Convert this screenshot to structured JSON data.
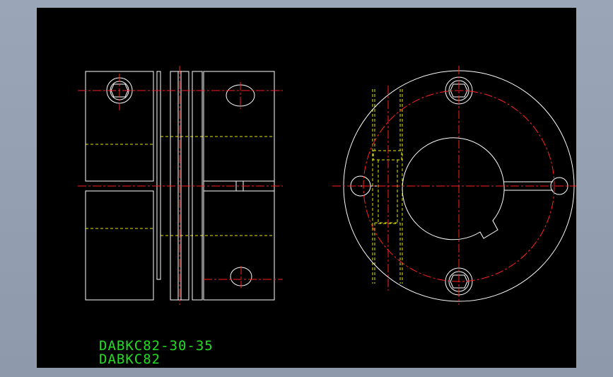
{
  "colors": {
    "background": "#000000",
    "outline": "#ffffff",
    "centerline": "#ff2020",
    "hidden_line": "#e6e600",
    "text": "#22dd22"
  },
  "labels": {
    "part_number": "DABKC82-30-35",
    "series": "DABKC82"
  }
}
